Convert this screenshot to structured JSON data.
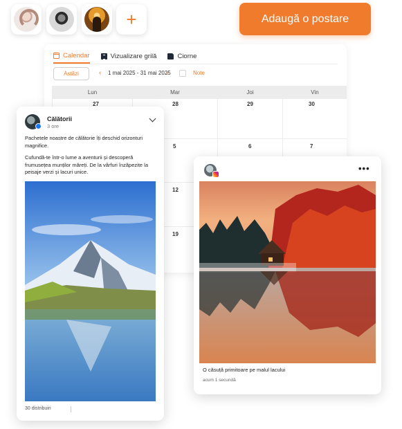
{
  "header": {
    "add_post_label": "Adaugă o postare",
    "plus_label": "+",
    "accounts": [
      {
        "name": "profile-woman"
      },
      {
        "name": "profile-bearded-man"
      },
      {
        "name": "profile-sunset"
      }
    ]
  },
  "calendar": {
    "tabs": [
      {
        "label": "Calendar",
        "icon": "calendar-icon",
        "active": true
      },
      {
        "label": "Vizualizare grilă",
        "icon": "grid-view-icon",
        "active": false
      },
      {
        "label": "Ciorne",
        "icon": "drafts-icon",
        "active": false
      }
    ],
    "today_label": "Astăzi",
    "prev_arrow": "‹",
    "next_arrow": "›",
    "date_range": "1 mai 2025 - 31 mai 2025",
    "notes_label": "Note",
    "days": [
      "Lun",
      "Mar",
      "Joi",
      "Vin"
    ],
    "weeks": [
      [
        "27",
        "28",
        "29",
        "30"
      ],
      [
        "5",
        "6",
        "7",
        ""
      ],
      [
        "12",
        "",
        "",
        ""
      ],
      [
        "19",
        "",
        "",
        ""
      ]
    ]
  },
  "facebook_post": {
    "author": "Călătorii",
    "time": "3 ore",
    "text_line1": "Pachetele noastre de călătorie îți deschid orizonturi magnifice.",
    "text_line2": "Cufundă-te într-o lume a aventurii și descoperă frumusețea munților măreți. De la vârfuri înzăpezite la peisaje verzi și lacuri unice.",
    "shares": "30 distribuiri"
  },
  "instagram_post": {
    "more_icon": "•••",
    "caption": "O căsuță primitoare pe malul lacului",
    "time": "acum 1 secundă"
  },
  "colors": {
    "accent": "#f07b2c",
    "facebook_blue": "#1877f2"
  }
}
